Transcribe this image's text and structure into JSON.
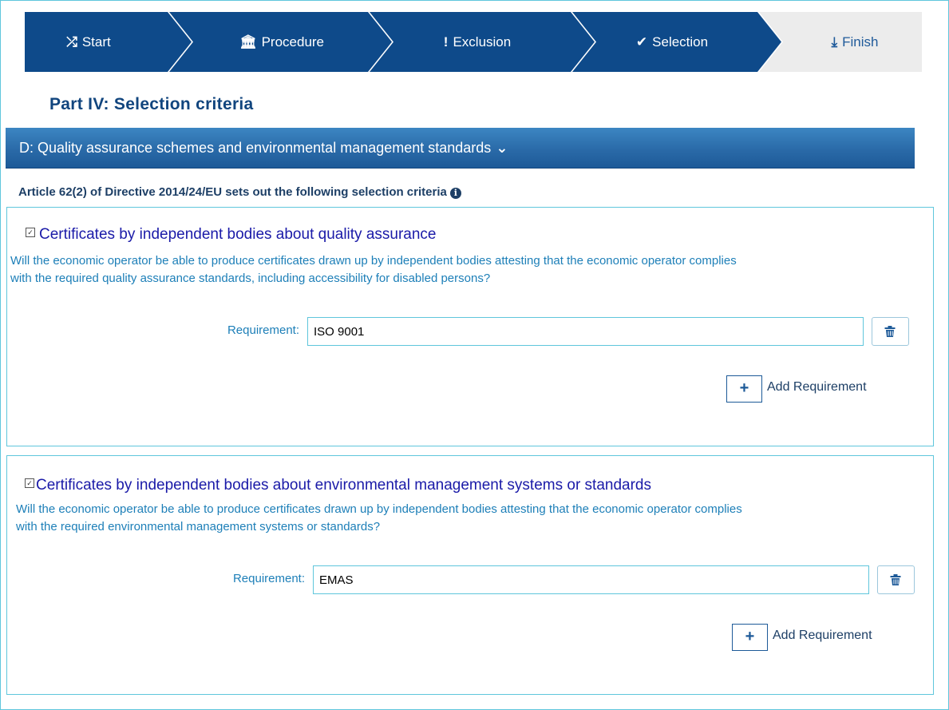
{
  "wizard": {
    "steps": [
      {
        "label": "Start",
        "icon": "shuffle-icon",
        "state": "done"
      },
      {
        "label": "Procedure",
        "icon": "institution-icon",
        "state": "done"
      },
      {
        "label": "Exclusion",
        "icon": "exclamation-icon",
        "state": "done"
      },
      {
        "label": "Selection",
        "icon": "check-circle-icon",
        "state": "active"
      },
      {
        "label": "Finish",
        "icon": "download-icon",
        "state": "pending"
      }
    ],
    "colors": {
      "done": "#0e4a8a",
      "pending": "#ececec"
    }
  },
  "page": {
    "title": "Part IV: Selection criteria"
  },
  "section": {
    "title": "D: Quality assurance schemes and environmental management standards"
  },
  "article": {
    "text": "Article 62(2) of Directive 2014/24/EU sets out the following selection criteria"
  },
  "criteria": [
    {
      "title": "Certificates by independent bodies about quality assurance",
      "description_line1": "Will the economic operator be able to produce certificates drawn up by independent bodies attesting that the economic operator complies",
      "description_line2": "with the required quality assurance standards, including accessibility for disabled persons?",
      "requirement_label": "Requirement:",
      "requirement_value": "ISO 9001",
      "add_label": "Add Requirement"
    },
    {
      "title": "Certificates by independent bodies about environmental management systems or standards",
      "description_line1": "Will the economic operator be able to produce certificates drawn up by independent bodies attesting that the economic operator complies",
      "description_line2": "with the required environmental management systems or standards?",
      "requirement_label": "Requirement:",
      "requirement_value": "EMAS",
      "add_label": "Add Requirement"
    }
  ]
}
